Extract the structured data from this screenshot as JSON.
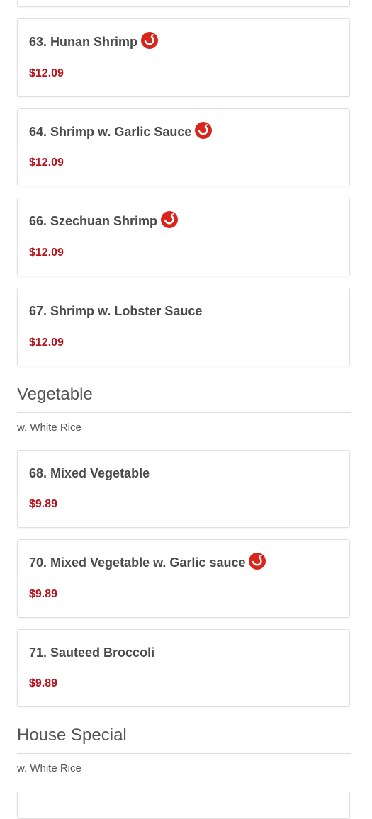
{
  "colors": {
    "price": "#b5121b",
    "spicy_icon": "#d9261c"
  },
  "section_shrimp": {
    "items": [
      {
        "name": "63. Hunan Shrimp",
        "price": "$12.09",
        "spicy": true
      },
      {
        "name": "64. Shrimp w. Garlic Sauce",
        "price": "$12.09",
        "spicy": true
      },
      {
        "name": "66. Szechuan Shrimp",
        "price": "$12.09",
        "spicy": true
      },
      {
        "name": "67. Shrimp w. Lobster Sauce",
        "price": "$12.09",
        "spicy": false
      }
    ]
  },
  "section_vegetable": {
    "title": "Vegetable",
    "subtitle": "w. White Rice",
    "items": [
      {
        "name": "68. Mixed Vegetable",
        "price": "$9.89",
        "spicy": false
      },
      {
        "name": "70. Mixed Vegetable w. Garlic sauce",
        "price": "$9.89",
        "spicy": true
      },
      {
        "name": "71. Sauteed Broccoli",
        "price": "$9.89",
        "spicy": false
      }
    ]
  },
  "section_house_special": {
    "title": "House Special",
    "subtitle": "w. White Rice"
  }
}
